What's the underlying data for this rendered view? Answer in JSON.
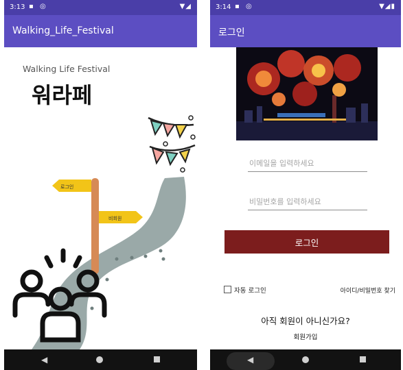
{
  "screen1": {
    "status_time": "3:13",
    "app_title": "Walking_Life_Festival",
    "subtitle": "Walking Life Festival",
    "title": "워라페",
    "sign_left": "로그인",
    "sign_right": "비회원"
  },
  "screen2": {
    "status_time": "3:14",
    "app_title": "로그인",
    "email_placeholder": "이메일을 입력하세요",
    "password_placeholder": "비밀번호를 입력하세요",
    "login_button": "로그인",
    "auto_login": "자동 로그인",
    "find_account": "아이디/비밀번호 찾기",
    "not_member": "아직 회원이 아니신가요?",
    "signup": "회원가입"
  },
  "colors": {
    "status_bar": "#4a3ea8",
    "app_bar": "#5c4ec2",
    "login_button": "#7c1d1d",
    "nav_bar": "#121212"
  },
  "icons": [
    "back-icon",
    "home-icon",
    "recents-icon",
    "wifi-icon",
    "signal-icon",
    "battery-icon"
  ]
}
